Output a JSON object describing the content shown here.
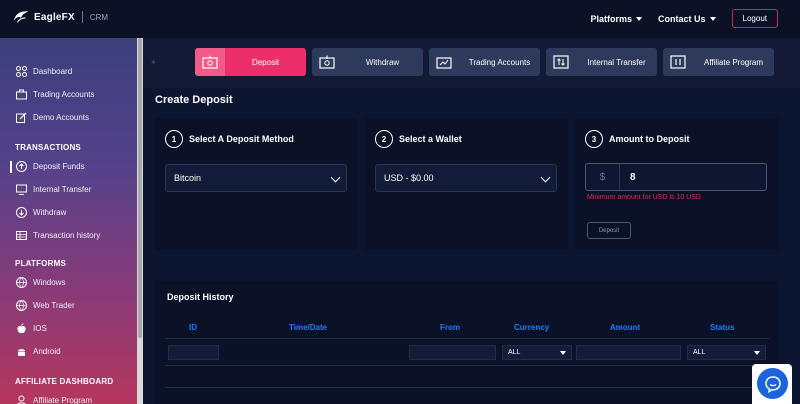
{
  "brand": {
    "name": "EagleFX",
    "suffix": "CRM"
  },
  "topnav": {
    "platforms": "Platforms",
    "contact": "Contact Us",
    "logout": "Logout"
  },
  "sidebar": {
    "items_top": [
      {
        "label": "Dashboard",
        "icon": "dashboard-icon"
      },
      {
        "label": "Trading Accounts",
        "icon": "briefcase-icon"
      },
      {
        "label": "Demo Accounts",
        "icon": "edit-icon"
      }
    ],
    "transactions_head": "TRANSACTIONS",
    "transactions": [
      {
        "label": "Deposit Funds",
        "icon": "arrow-up-circle-icon"
      },
      {
        "label": "Internal Transfer",
        "icon": "monitor-icon"
      },
      {
        "label": "Withdraw",
        "icon": "arrow-down-circle-icon"
      },
      {
        "label": "Transaction history",
        "icon": "table-icon"
      }
    ],
    "platforms_head": "PLATFORMS",
    "platforms": [
      {
        "label": "Windows",
        "icon": "windows-icon"
      },
      {
        "label": "Web Trader",
        "icon": "globe-icon"
      },
      {
        "label": "IOS",
        "icon": "apple-icon"
      },
      {
        "label": "Android",
        "icon": "android-icon"
      }
    ],
    "affiliate_head": "AFFILIATE DASHBOARD",
    "affiliate": [
      {
        "label": "Affiliate Program",
        "icon": "user-icon"
      }
    ]
  },
  "tabs": [
    {
      "label": "Deposit",
      "active": true
    },
    {
      "label": "Withdraw",
      "active": false
    },
    {
      "label": "Trading Accounts",
      "active": false
    },
    {
      "label": "Internal Transfer",
      "active": false
    },
    {
      "label": "Affiliate Program",
      "active": false
    }
  ],
  "page_title": "Create Deposit",
  "steps": {
    "method": {
      "num": "1",
      "title": "Select A Deposit Method",
      "value": "Bitcoin"
    },
    "wallet": {
      "num": "2",
      "title": "Select a Wallet",
      "value": "USD - $0.00"
    },
    "amount": {
      "num": "3",
      "title": "Amount to Deposit",
      "currency": "$",
      "value": "8",
      "note": "Minimum amount for USD is 10 USD",
      "button": "Deposit"
    }
  },
  "history": {
    "title": "Deposit History",
    "columns": [
      "ID",
      "Time/Date",
      "From",
      "Currency",
      "Amount",
      "Status"
    ],
    "currency_filter": "ALL",
    "status_filter": "ALL"
  },
  "colors": {
    "accent": "#ec2f6b",
    "link_blue": "#1e7bff",
    "error": "#e0284f"
  }
}
